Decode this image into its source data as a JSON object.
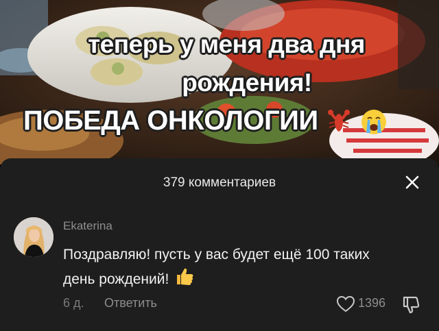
{
  "video": {
    "caption_line1": "теперь у меня два дня",
    "caption_line2": "рождения!",
    "caption_line3": "ПОБЕДА ОНКОЛОГИИ",
    "caption_emojis": [
      "lobster-emoji",
      "crying-face-emoji"
    ]
  },
  "comments_panel": {
    "count_label": "379 комментариев",
    "close_icon": "close-icon",
    "background_color": "#1e1e1e"
  },
  "comment": {
    "username": "Ekaterina",
    "text": "Поздравляю! пусть у вас будет ещё 100 таких день рождений!",
    "emoji": "thumbs-up-emoji",
    "time": "6 д.",
    "reply_label": "Ответить",
    "likes": "1396",
    "like_icon": "heart-outline-icon",
    "dislike_icon": "thumbs-down-icon"
  }
}
